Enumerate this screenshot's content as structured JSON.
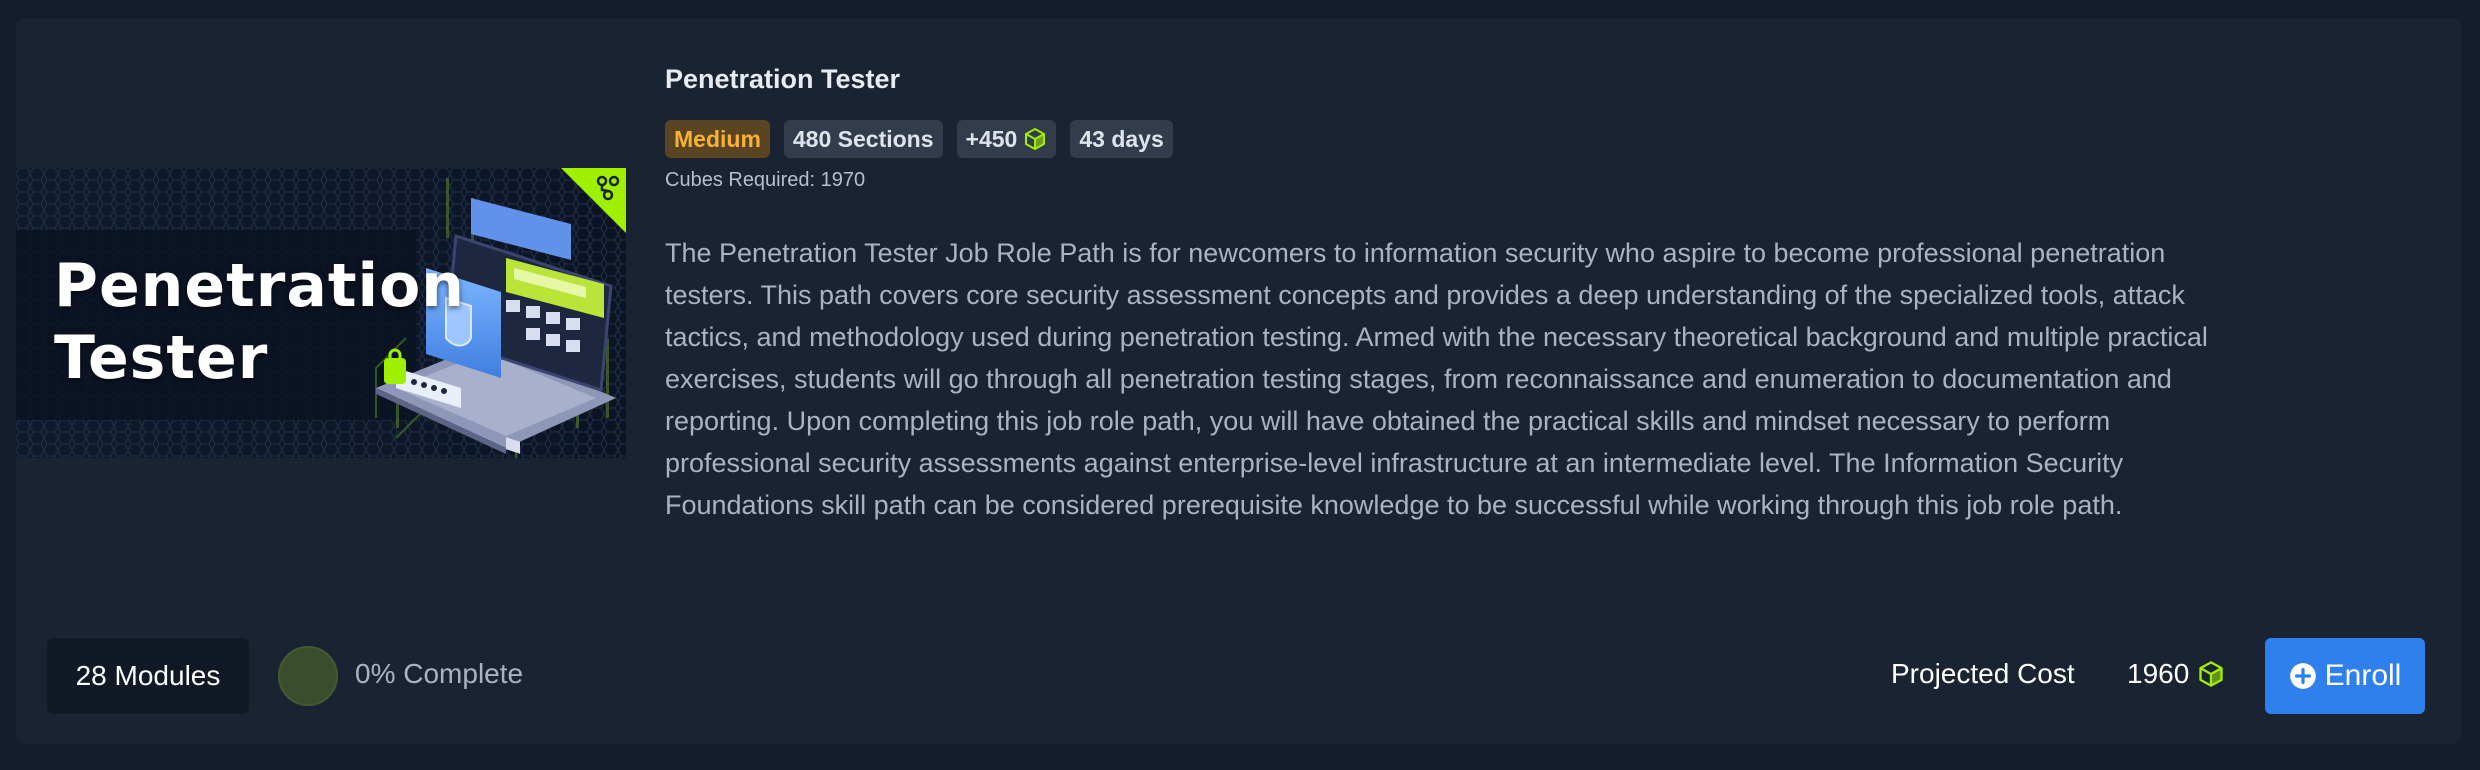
{
  "path": {
    "title": "Penetration Tester",
    "thumbnail_title": "Penetration\nTester",
    "badges": {
      "difficulty": "Medium",
      "sections": "480 Sections",
      "cubes_reward": "+450",
      "duration": "43 days"
    },
    "cubes_required": "Cubes Required: 1970",
    "description": "The Penetration Tester Job Role Path is for newcomers to information security who aspire to become professional penetration testers. This path covers core security assessment concepts and provides a deep understanding of the specialized tools, attack tactics, and methodology used during penetration testing. Armed with the necessary theoretical background and multiple practical exercises, students will go through all penetration testing stages, from reconnaissance and enumeration to documentation and reporting. Upon completing this job role path, you will have obtained the practical skills and mindset necessary to perform professional security assessments against enterprise-level infrastructure at an intermediate level. The Information Security Foundations skill path can be considered prerequisite knowledge to be successful while working through this job role path."
  },
  "footer": {
    "modules": "28 Modules",
    "progress_label": "0% Complete",
    "progress_percent": 0,
    "projected_cost_label": "Projected Cost",
    "projected_cost_value": "1960",
    "enroll_label": "Enroll"
  },
  "icons": {
    "cube": "cube-icon",
    "plus": "plus-circle-icon",
    "path": "path-branch-icon"
  },
  "colors": {
    "background": "#141d2b",
    "card": "#1a2332",
    "accent_green": "#9fef00",
    "medium_text": "#f5b236",
    "enroll_blue": "#2f80ed"
  }
}
